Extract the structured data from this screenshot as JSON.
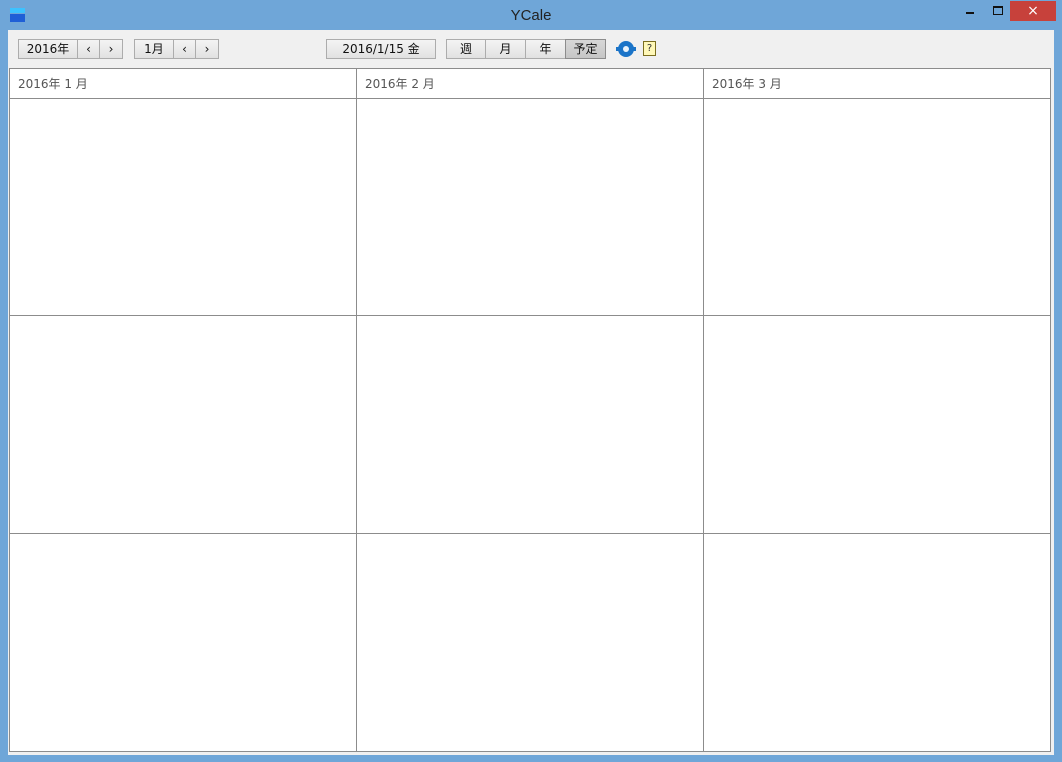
{
  "window": {
    "title": "YCale",
    "close_glyph": "×"
  },
  "toolbar": {
    "year_label": "2016年",
    "prev_glyph": "‹",
    "next_glyph": "›",
    "month_label": "1月",
    "today_label": "2016/1/15  金",
    "views": [
      {
        "label": "週",
        "active": false
      },
      {
        "label": "月",
        "active": false
      },
      {
        "label": "年",
        "active": false
      },
      {
        "label": "予定",
        "active": true
      }
    ],
    "help_glyph": "?"
  },
  "calendar": {
    "months": [
      "2016年 1 月",
      "2016年 2 月",
      "2016年 3 月"
    ]
  },
  "icons": {
    "app": "app-calendar-icon",
    "settings": "gear-icon",
    "help": "help-icon"
  },
  "colors": {
    "titlebar": "#6fa6d8",
    "close_button": "#c7413b",
    "grid_line": "#8c8c8c",
    "settings_icon": "#1b74c8"
  }
}
